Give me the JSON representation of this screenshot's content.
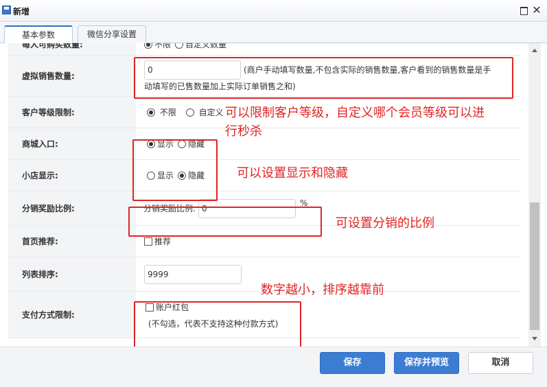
{
  "window": {
    "title": "新增"
  },
  "tabs": [
    {
      "label": "基本参数"
    },
    {
      "label": "微信分享设置"
    }
  ],
  "form": {
    "limit_buy": {
      "label": "每人可购买数量:",
      "options": [
        "不限",
        "自定义数量"
      ]
    },
    "virtual_sales": {
      "label": "虚拟销售数量:",
      "value": "0",
      "hint_line1": "(商户手动填写数量,不包含实际的销售数量,客户看到的销售数量是手",
      "hint_line2": "动填写的已售数量加上实际订单销售之和)"
    },
    "customer_level": {
      "label": "客户等级限制:",
      "options": [
        "不限",
        "自定义"
      ]
    },
    "mall_entry": {
      "label": "商城入口:",
      "options": [
        "显示",
        "隐藏"
      ],
      "selected": "显示"
    },
    "shop_display": {
      "label": "小店显示:",
      "options": [
        "显示",
        "隐藏"
      ],
      "selected": "隐藏"
    },
    "distribution": {
      "label": "分销奖励比例:",
      "sub_label": "分销奖励比例:",
      "value": "0",
      "unit": "%"
    },
    "homepage": {
      "label": "首页推荐:",
      "option": "推荐"
    },
    "sort": {
      "label": "列表排序:",
      "value": "9999"
    },
    "payment": {
      "label": "支付方式限制:",
      "option": "账户红包",
      "note": "(不勾选，代表不支持这种付款方式)"
    }
  },
  "annotations": {
    "level_line1": "可以限制客户等级，自定义哪个会员等级可以进",
    "level_line2": "行秒杀",
    "display": "可以设置显示和隐藏",
    "distribution": "可设置分销的比例",
    "sort": "数字越小，排序越靠前"
  },
  "buttons": {
    "save": "保存",
    "save_preview": "保存并预览",
    "cancel": "取消"
  },
  "colors": {
    "primary": "#3c7dd4",
    "annotation": "#e02424",
    "tab_accent": "#2f6fbf"
  }
}
